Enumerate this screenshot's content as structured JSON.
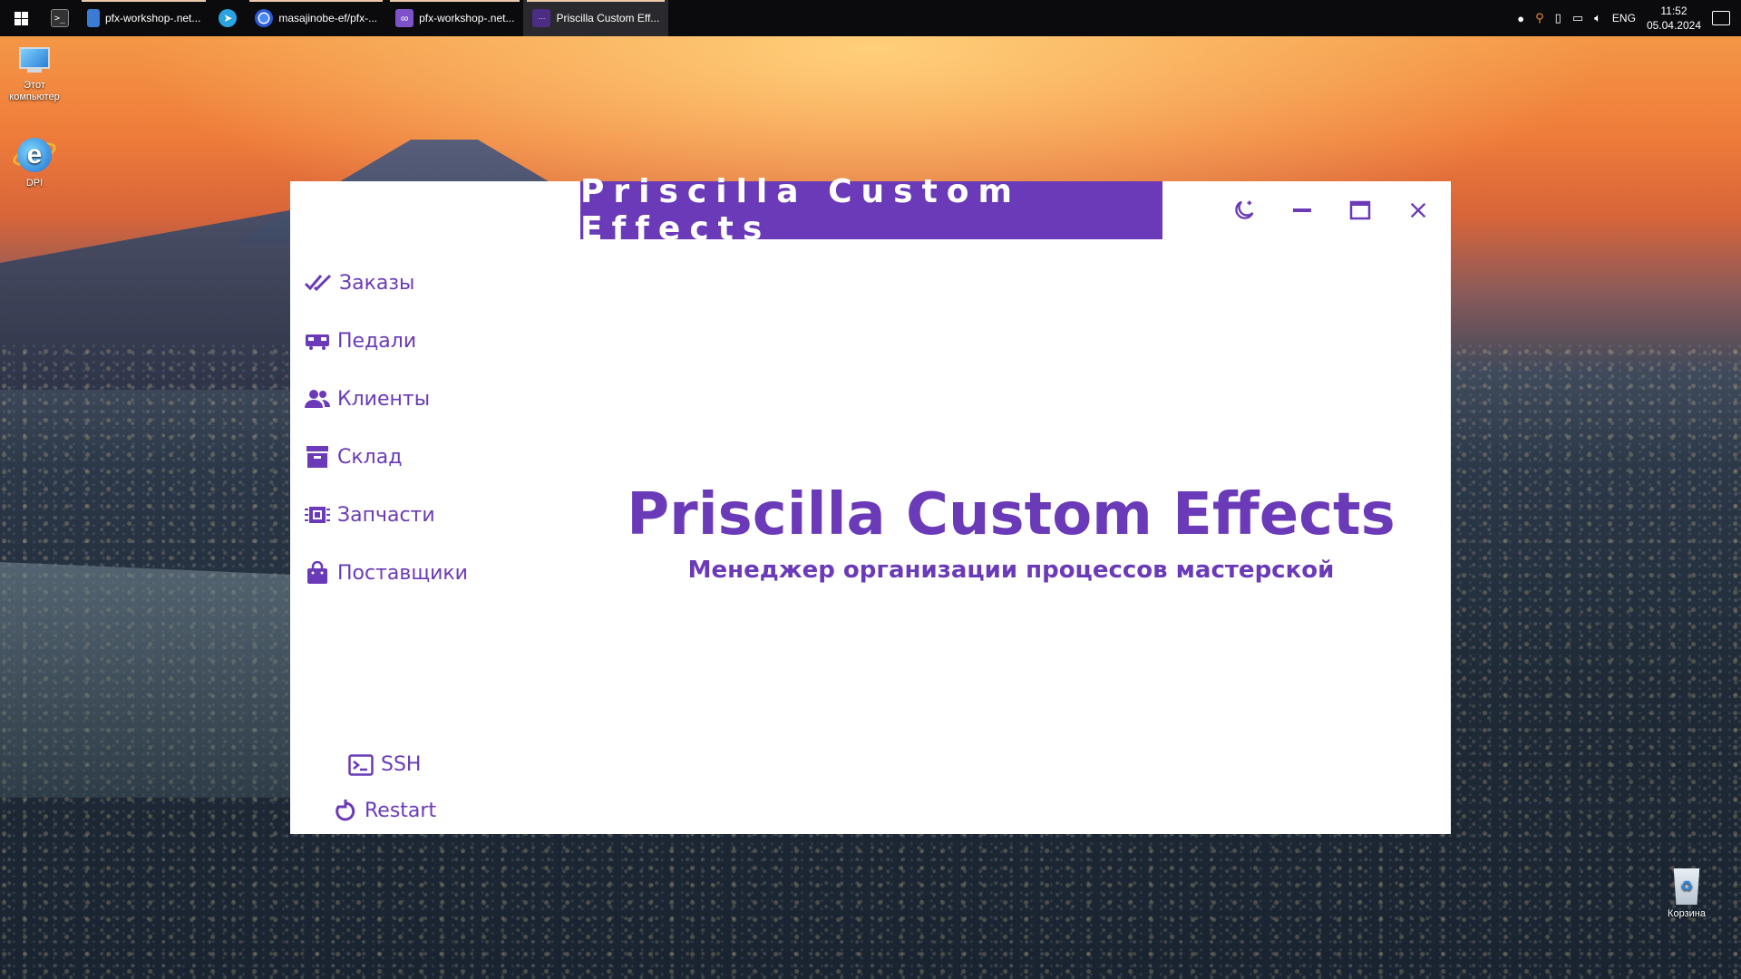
{
  "taskbar": {
    "items": [
      {
        "label": "pfx-workshop-.net...",
        "icon": "file-icon"
      },
      {
        "label": "",
        "icon": "telegram-icon"
      },
      {
        "label": "masajinobe-ef/pfx-...",
        "icon": "chrome-icon"
      },
      {
        "label": "pfx-workshop-.net...",
        "icon": "visual-studio-icon"
      },
      {
        "label": "Priscilla Custom Eff...",
        "icon": "app-icon"
      }
    ],
    "lang": "ENG",
    "time": "11:52",
    "date": "05.04.2024"
  },
  "desktop": {
    "this_pc": "Этот компьютер",
    "dpi": "DPI",
    "recycle_bin": "Корзина"
  },
  "app": {
    "title": "Priscilla Custom Effects",
    "accent_color": "#6a3ab8",
    "nav": [
      {
        "label": "Заказы",
        "icon": "double-check-icon"
      },
      {
        "label": "Педали",
        "icon": "pedal-icon"
      },
      {
        "label": "Клиенты",
        "icon": "people-icon"
      },
      {
        "label": "Склад",
        "icon": "archive-box-icon"
      },
      {
        "label": "Запчасти",
        "icon": "chip-icon"
      },
      {
        "label": "Поставщики",
        "icon": "shopping-bag-icon"
      }
    ],
    "actions": {
      "ssh": "SSH",
      "restart": "Restart"
    },
    "hero": {
      "title": "Priscilla Custom Effects",
      "subtitle": "Менеджер организации процессов мастерской"
    }
  }
}
